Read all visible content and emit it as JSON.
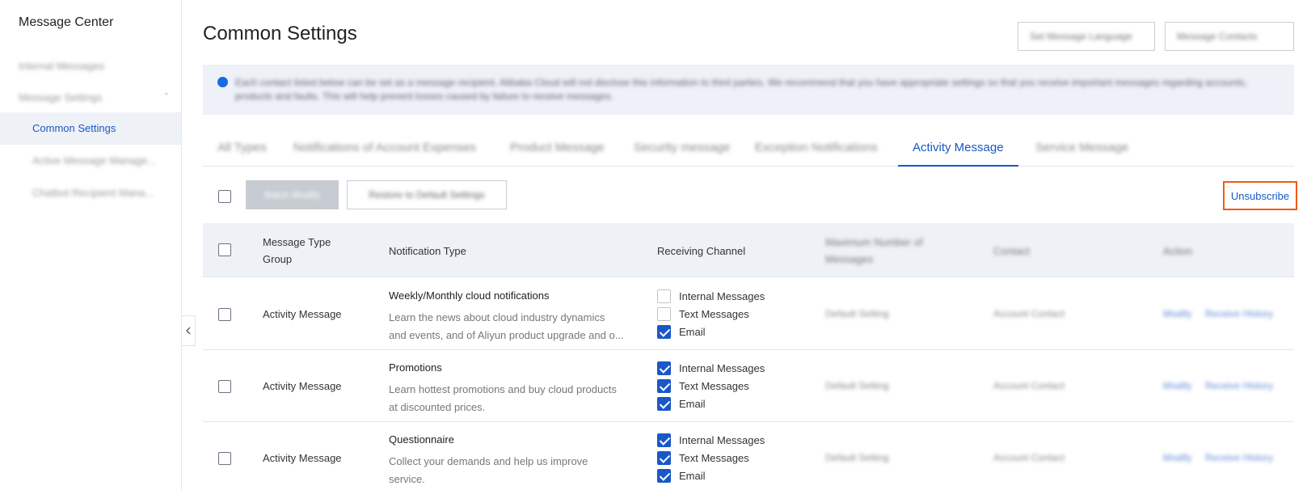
{
  "sidebar": {
    "title": "Message Center",
    "items": [
      {
        "label": "Internal Messages"
      },
      {
        "label": "Message Settings"
      },
      {
        "label": "Common Settings"
      },
      {
        "label": "Active Message Manage..."
      },
      {
        "label": "Chatbot Recipient Mana..."
      }
    ]
  },
  "header": {
    "title": "Common Settings",
    "buttons": [
      "Set Message Language",
      "Message Contacts"
    ]
  },
  "notice": {
    "text": "Each contact listed below can be set as a message recipient. Alibaba Cloud will not disclose this information to third parties. We recommend that you have appropriate settings so that you receive important messages regarding accounts, products and faults. This will help prevent losses caused by failure to receive messages."
  },
  "tabs": [
    {
      "label": "All Types"
    },
    {
      "label": "Notifications of Account Expenses"
    },
    {
      "label": "Product Message"
    },
    {
      "label": "Security message"
    },
    {
      "label": "Exception Notifications"
    },
    {
      "label": "Activity Message"
    },
    {
      "label": "Service Message"
    }
  ],
  "toolbar": {
    "batch_label": "Batch Modify",
    "restore_label": "Restore to Default Settings",
    "unsubscribe_label": "Unsubscribe"
  },
  "table": {
    "headers": {
      "group_line1": "Message Type",
      "group_line2": "Group",
      "notification": "Notification Type",
      "channel": "Receiving Channel",
      "max_line1": "Maximum Number of",
      "max_line2": "Messages",
      "contact": "Contact",
      "action": "Action"
    },
    "rows": [
      {
        "group": "Activity Message",
        "title": "Weekly/Monthly cloud notifications",
        "desc1": "Learn the news about cloud industry dynamics",
        "desc2": "and events, and of Aliyun product upgrade and o...",
        "channels": [
          {
            "label": "Internal Messages",
            "checked": false
          },
          {
            "label": "Text Messages",
            "checked": false
          },
          {
            "label": "Email",
            "checked": true
          }
        ],
        "max": "Default Setting",
        "contact": "Account Contact",
        "action_modify": "Modify",
        "action_history": "Receive History"
      },
      {
        "group": "Activity Message",
        "title": "Promotions",
        "desc1": "Learn hottest promotions and buy cloud products",
        "desc2": "at discounted prices.",
        "channels": [
          {
            "label": "Internal Messages",
            "checked": true
          },
          {
            "label": "Text Messages",
            "checked": true
          },
          {
            "label": "Email",
            "checked": true
          }
        ],
        "max": "Default Setting",
        "contact": "Account Contact",
        "action_modify": "Modify",
        "action_history": "Receive History"
      },
      {
        "group": "Activity Message",
        "title": "Questionnaire",
        "desc1": "Collect your demands and help us improve",
        "desc2": "service.",
        "channels": [
          {
            "label": "Internal Messages",
            "checked": true
          },
          {
            "label": "Text Messages",
            "checked": true
          },
          {
            "label": "Email",
            "checked": true
          }
        ],
        "max": "Default Setting",
        "contact": "Account Contact",
        "action_modify": "Modify",
        "action_history": "Receive History"
      }
    ]
  },
  "colors": {
    "accent": "#1a58c7",
    "highlight": "#f05a12",
    "header_bg": "#eef1f6"
  }
}
